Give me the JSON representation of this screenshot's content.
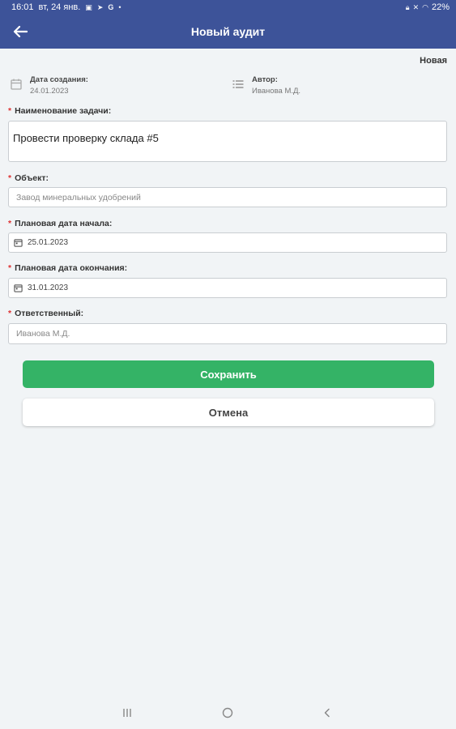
{
  "status_bar": {
    "time": "16:01",
    "date": "вт, 24 янв.",
    "battery": "22%",
    "icons": [
      "gallery-icon",
      "telegram-icon",
      "google-icon",
      "dot-icon",
      "lock-icon",
      "mute-icon",
      "wifi-icon",
      "battery-icon"
    ]
  },
  "app_bar": {
    "title": "Новый аудит",
    "back_icon": "arrow-left-icon"
  },
  "audit": {
    "status": "Новая",
    "created_label": "Дата создания:",
    "created_value": "24.01.2023",
    "created_icon": "calendar-icon",
    "author_label": "Автор:",
    "author_value": "Иванова М.Д.",
    "author_icon": "list-icon"
  },
  "form": {
    "required_mark": "*",
    "task_name": {
      "label": "Наименование задачи:",
      "value": "Провести проверку склада #5"
    },
    "object": {
      "label": "Объект:",
      "value": "Завод минеральных удобрений"
    },
    "start_date": {
      "label": "Плановая дата начала:",
      "value": "25.01.2023",
      "icon": "calendar-icon"
    },
    "end_date": {
      "label": "Плановая дата окончания:",
      "value": "31.01.2023",
      "icon": "calendar-icon"
    },
    "responsible": {
      "label": "Ответственный:",
      "value": "Иванова М.Д."
    }
  },
  "buttons": {
    "save_label": "Сохранить",
    "cancel_label": "Отмена"
  },
  "colors": {
    "primary": "#3d5399",
    "success": "#34b366",
    "background": "#f1f4f6",
    "required": "#d33333"
  },
  "nav_bar": {
    "icons": [
      "recent-apps-icon",
      "home-icon",
      "back-icon"
    ]
  }
}
